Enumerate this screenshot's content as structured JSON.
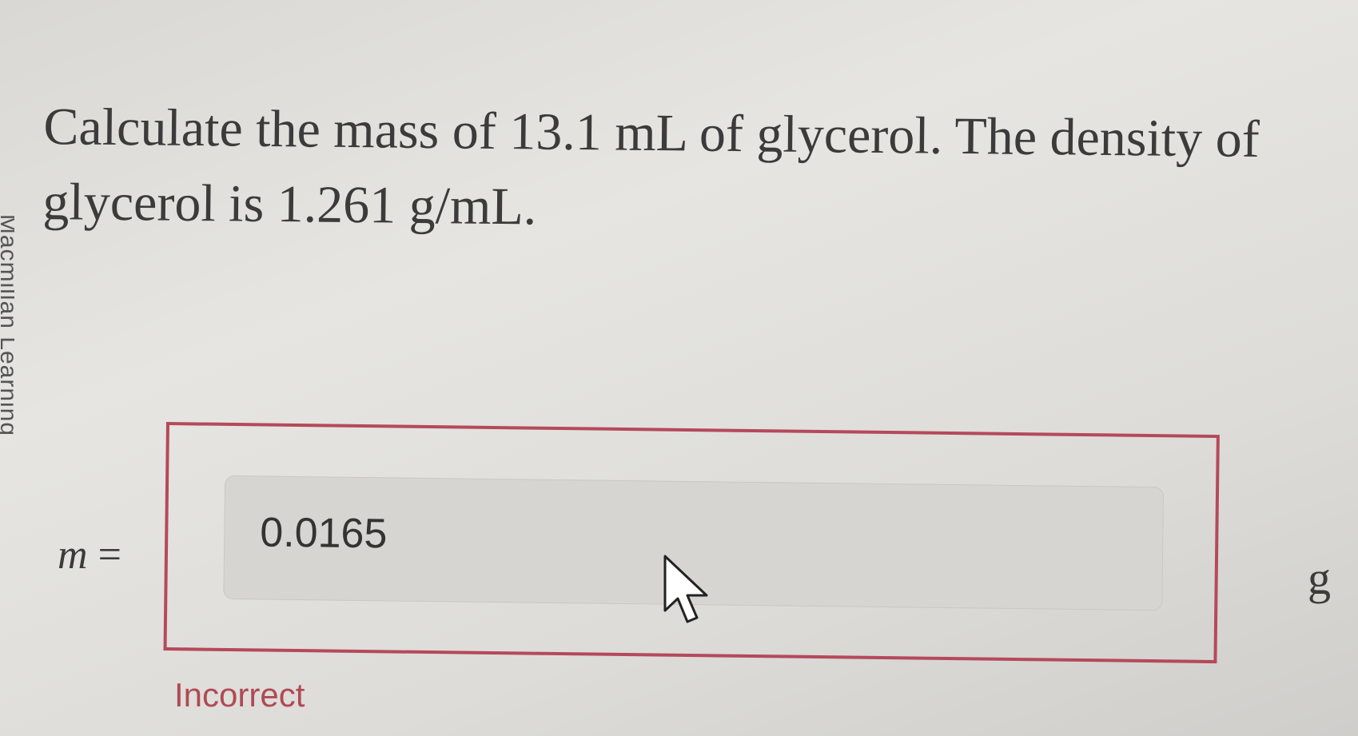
{
  "sidebar": {
    "brand_text": "Macmillan Learning"
  },
  "question": {
    "text": "Calculate the mass of 13.1 mL of glycerol. The density of glycerol is 1.261 g/mL."
  },
  "answer": {
    "variable": "m",
    "equals": "=",
    "value": "0.0165",
    "unit": "g",
    "feedback": "Incorrect",
    "feedback_color": "#b04a55",
    "border_color": "#b5495b"
  },
  "icons": {
    "cursor": "mouse-pointer-icon"
  }
}
